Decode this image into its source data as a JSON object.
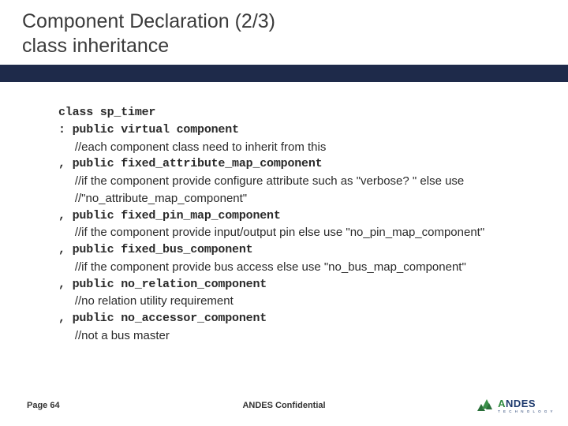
{
  "title": {
    "line1": "Component Declaration (2/3)",
    "line2": "class inheritance"
  },
  "code": {
    "l0": "class sp_timer",
    "l1": ": public virtual component",
    "c1": "     //each component class need to inherit from this",
    "l2": ", public fixed_attribute_map_component",
    "c2a": "     //if the component provide configure attribute such as \"verbose? \" else use",
    "c2b": "     //\"no_attribute_map_component\"",
    "l3": ", public fixed_pin_map_component",
    "c3": "     //if the component provide input/output pin else use \"no_pin_map_component\"",
    "l4": ", public fixed_bus_component",
    "c4": "     //if the component provide bus access else use \"no_bus_map_component\"",
    "l5": ", public no_relation_component",
    "c5": "     //no relation utility requirement",
    "l6": ", public no_accessor_component",
    "c6": "     //not a bus master"
  },
  "footer": {
    "page_label": "Page 64",
    "confidential": "ANDES Confidential",
    "logo_text_a": "A",
    "logo_text_rest": "NDES",
    "logo_sub": "T E C H N O L O G Y"
  }
}
